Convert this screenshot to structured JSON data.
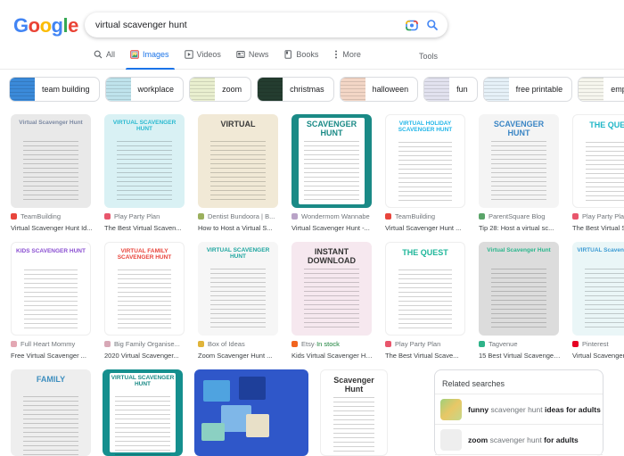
{
  "search": {
    "query": "virtual scavenger hunt",
    "lens_icon": "google-lens-icon",
    "search_icon": "magnifier-icon"
  },
  "logo": {
    "letters": [
      "G",
      "o",
      "o",
      "g",
      "l",
      "e"
    ],
    "colors": [
      "#4285f4",
      "#ea4335",
      "#fbbc05",
      "#4285f4",
      "#34a853",
      "#ea4335"
    ]
  },
  "tabs": [
    {
      "label": "All",
      "icon": "search-icon",
      "active": false
    },
    {
      "label": "Images",
      "icon": "image-icon",
      "active": true
    },
    {
      "label": "Videos",
      "icon": "play-icon",
      "active": false
    },
    {
      "label": "News",
      "icon": "newspaper-icon",
      "active": false
    },
    {
      "label": "Books",
      "icon": "book-icon",
      "active": false
    },
    {
      "label": "More",
      "icon": "more-vert-icon",
      "active": false
    }
  ],
  "tools_label": "Tools",
  "chips": [
    {
      "label": "team building",
      "color": "#3b8ad9"
    },
    {
      "label": "workplace",
      "color": "#bfe3ec"
    },
    {
      "label": "zoom",
      "color": "#e9efcf"
    },
    {
      "label": "christmas",
      "color": "#243d30"
    },
    {
      "label": "halloween",
      "color": "#f3d6c6"
    },
    {
      "label": "fun",
      "color": "#e2e2ef"
    },
    {
      "label": "free printable",
      "color": "#e6f1f8"
    },
    {
      "label": "employee",
      "color": "#f6f6ee"
    }
  ],
  "rows": [
    [
      {
        "source": "TeamBuilding",
        "title": "Virtual Scavenger Hunt Id...",
        "fav": "#e8453c",
        "bg": "#e9e9e9",
        "accent": "#7d8aa3",
        "heading": "Virtual Scavenger Hunt"
      },
      {
        "source": "Play Party Plan",
        "title": "The Best Virtual Scaven...",
        "fav": "#e8566c",
        "bg": "#d9f1f4",
        "accent": "#2bbad0",
        "heading": "VIRTUAL SCAVENGER HUNT"
      },
      {
        "source": "Dentist Bundoora | B...",
        "title": "How to Host a Virtual S...",
        "fav": "#9bb05d",
        "bg": "#f1e9d6",
        "accent": "#3a3a3a",
        "heading": "VIRTUAL"
      },
      {
        "source": "Wondermom Wannabe",
        "title": "Virtual Scavenger Hunt -...",
        "fav": "#b9a3c7",
        "bg": "#1a8a86",
        "accent": "#ffffff",
        "heading": "SCAVENGER HUNT"
      },
      {
        "source": "TeamBuilding",
        "title": "Virtual Scavenger Hunt ...",
        "fav": "#e8453c",
        "bg": "#ffffff",
        "accent": "#21b6e8",
        "heading": "VIRTUAL HOLIDAY SCAVENGER HUNT"
      },
      {
        "source": "ParentSquare Blog",
        "title": "Tip 28: Host a virtual sc...",
        "fav": "#5aa469",
        "bg": "#f4f4f4",
        "accent": "#3b86c5",
        "heading": "SCAVENGER HUNT"
      },
      {
        "source": "Play Party Plan",
        "title": "The Best Virtual Scaven...",
        "fav": "#e8566c",
        "bg": "#ffffff",
        "accent": "#1fb6c7",
        "heading": "THE QUEST"
      }
    ],
    [
      {
        "source": "Full Heart Mommy",
        "title": "Free Virtual Scavenger ...",
        "fav": "#e3a7b3",
        "bg": "#ffffff",
        "accent": "#8a4fd1",
        "heading": "KIDS SCAVENGER HUNT"
      },
      {
        "source": "Big Family Organise...",
        "title": "2020 Virtual Scavenger...",
        "fav": "#d7a8b6",
        "bg": "#ffffff",
        "accent": "#e8453c",
        "heading": "VIRTUAL FAMILY SCAVENGER HUNT"
      },
      {
        "source": "Box of Ideas",
        "title": "Zoom Scavenger Hunt ...",
        "fav": "#e0b43a",
        "bg": "#f6f6f6",
        "accent": "#1fa6a0",
        "heading": "VIRTUAL SCAVENGER HUNT"
      },
      {
        "source": "Etsy",
        "source_extra": "In stock",
        "title": "Kids Virtual Scavenger Hunt f...",
        "fav": "#f1641e",
        "bg": "#f6e8ef",
        "accent": "#333333",
        "heading": "INSTANT DOWNLOAD"
      },
      {
        "source": "Play Party Plan",
        "title": "The Best Virtual Scave...",
        "fav": "#e8566c",
        "bg": "#ffffff",
        "accent": "#1fb69a",
        "heading": "THE QUEST"
      },
      {
        "source": "Tagvenue",
        "title": "15 Best Virtual Scavenger H...",
        "fav": "#2eb389",
        "bg": "#dcdcdc",
        "accent": "#2bb68d",
        "heading": "Virtual Scavenger Hunt"
      },
      {
        "source": "Pinterest",
        "title": "Virtual Scavenger Hu...",
        "fav": "#e60023",
        "bg": "#eaf6f7",
        "accent": "#3c9bd4",
        "heading": "VIRTUAL Scavenger Hunt"
      }
    ],
    [
      {
        "bg": "#eeeeee",
        "accent": "#3f8fbf",
        "heading": "FAMILY"
      },
      {
        "bg": "#158f8e",
        "accent": "#ffffff",
        "heading": "VIRTUAL SCAVENGER HUNT"
      },
      {
        "bg": "#2f57c9",
        "accent": "#63c7bd",
        "heading": ""
      },
      {
        "bg": "#ffffff",
        "accent": "#333333",
        "heading": "Scavenger Hunt"
      }
    ]
  ],
  "related": {
    "heading": "Related searches",
    "items": [
      {
        "parts": [
          [
            "funny",
            true
          ],
          [
            " scavenger hunt ",
            false
          ],
          [
            "ideas for adults",
            true
          ]
        ],
        "thumb": "#b7cf84"
      },
      {
        "parts": [
          [
            "zoom",
            true
          ],
          [
            " scavenger hunt ",
            false
          ],
          [
            "for adults",
            true
          ]
        ],
        "thumb": "#eeeeee"
      }
    ]
  }
}
